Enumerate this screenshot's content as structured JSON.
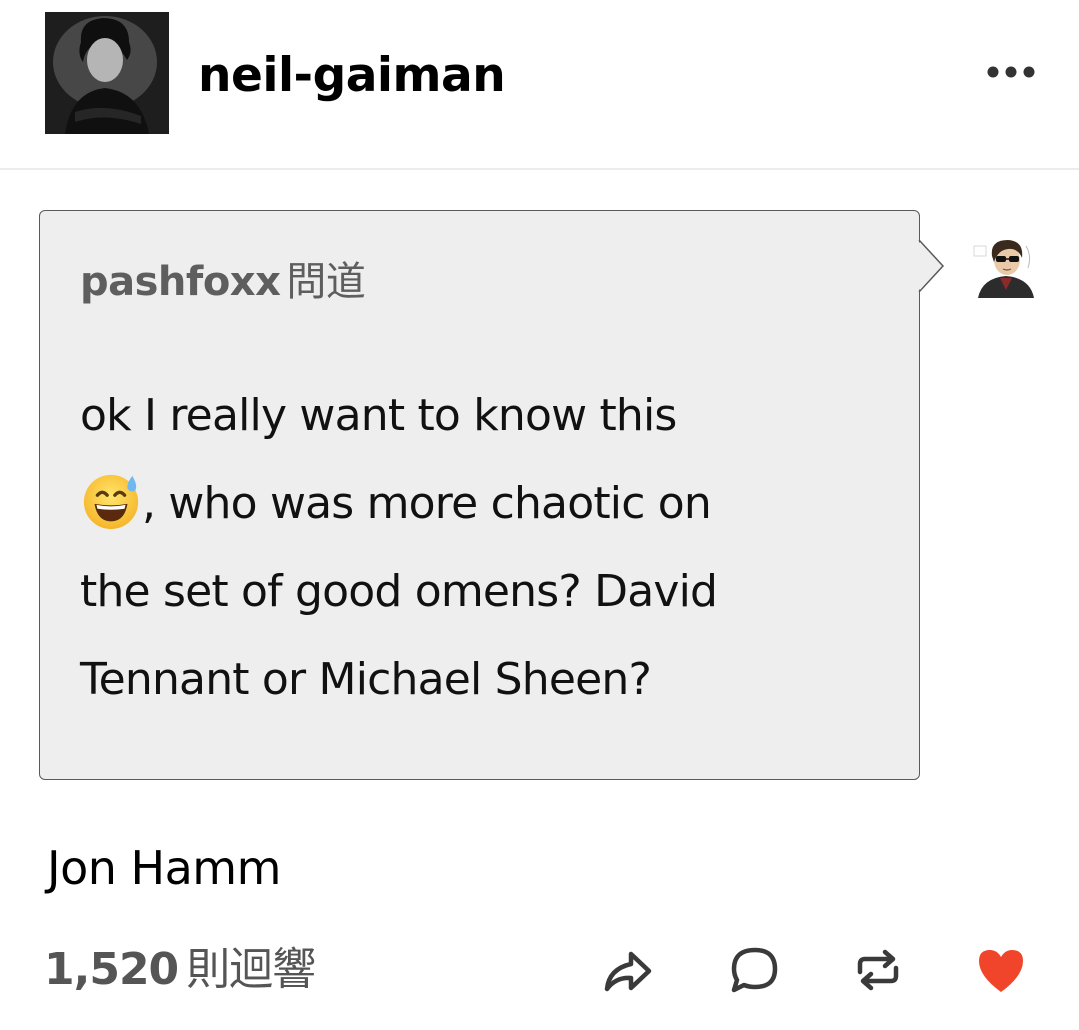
{
  "header": {
    "blog_name": "neil-gaiman",
    "avatar": "blog-avatar-photo",
    "more_icon": "ellipsis-icon"
  },
  "ask": {
    "asker_name": "pashfoxx",
    "asker_suffix": "問道",
    "question_lines": [
      "ok I really want to know this",
      ", who was more chaotic on",
      "the set of good omens?  David",
      "Tennant or Michael Sheen?"
    ],
    "emoji": "grinning-face-with-sweat-emoji"
  },
  "answer": "Jon Hamm",
  "footer": {
    "notes_count": "1,520",
    "notes_label": "則迴響",
    "icons": [
      "share-icon",
      "reply-icon",
      "reblog-icon",
      "like-icon"
    ]
  },
  "colors": {
    "like": "#f0452a",
    "bubble_bg": "#eeeeee",
    "secondary_text": "#555555"
  }
}
